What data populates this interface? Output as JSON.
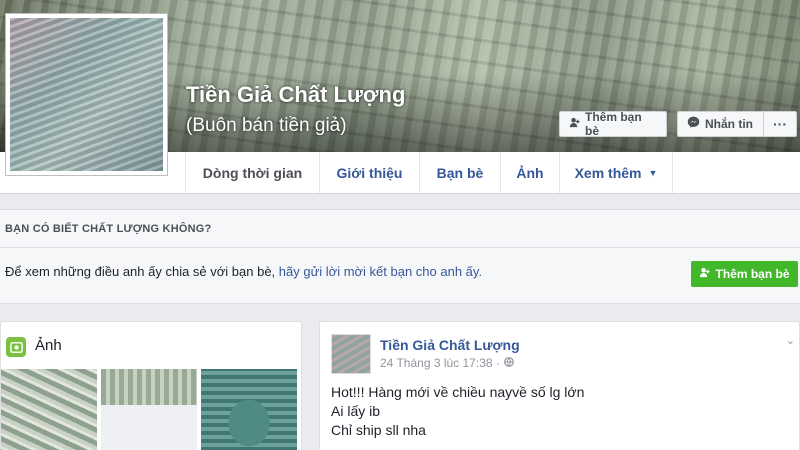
{
  "cover": {
    "title": "Tiền Giả Chất Lượng",
    "subtitle": "(Buôn bán tiền giả)",
    "add_friend_label": "Thêm bạn bè",
    "message_label": "Nhắn tin",
    "more_label": "···"
  },
  "nav": {
    "tabs": [
      {
        "label": "Dòng thời gian"
      },
      {
        "label": "Giới thiệu"
      },
      {
        "label": "Bạn bè"
      },
      {
        "label": "Ảnh"
      },
      {
        "label": "Xem thêm"
      }
    ]
  },
  "prompt": {
    "heading": "BẠN CÓ BIẾT CHẤT LƯỢNG KHÔNG?",
    "text_before": "Để xem những điều anh ấy chia sẻ với bạn bè, ",
    "link_text": "hãy gửi lời mời kết bạn cho anh ấy.",
    "button_label": "Thêm bạn bè"
  },
  "photos": {
    "title": "Ảnh"
  },
  "post": {
    "author": "Tiền Giả Chất Lượng",
    "timestamp": "24 Tháng 3 lúc 17:38 ·",
    "lines": [
      "Hot!!! Hàng mới về chiều nayvề số lg lớn",
      "Ai lấy ib",
      "Chỉ ship sll nha"
    ]
  },
  "colors": {
    "link_blue": "#365899",
    "green_button": "#42b72a",
    "page_background": "#e9ebee"
  },
  "icons": [
    "add-friend-icon",
    "messenger-icon",
    "globe-icon",
    "photos-icon",
    "caret-down-icon",
    "chevron-down-icon"
  ]
}
